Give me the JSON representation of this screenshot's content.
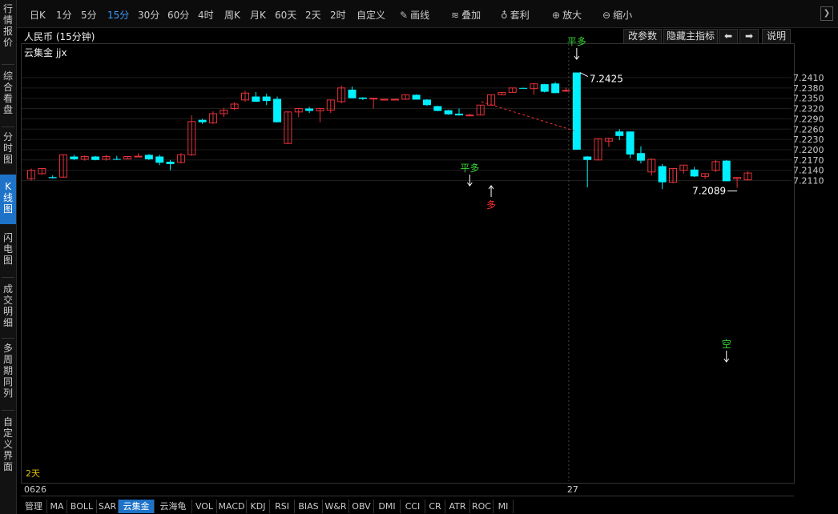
{
  "sidebar": {
    "items": [
      {
        "label": "行情报价",
        "active": false
      },
      {
        "label": "综合看盘",
        "active": false
      },
      {
        "label": "分时图",
        "active": false
      },
      {
        "label": "K线图",
        "active": true
      },
      {
        "label": "闪电图",
        "active": false
      },
      {
        "label": "成交明细",
        "active": false
      },
      {
        "label": "多周期同列",
        "active": false
      },
      {
        "label": "自定义界面",
        "active": false
      }
    ]
  },
  "toolbar": {
    "periods": [
      "日K",
      "1分",
      "5分",
      "15分",
      "30分",
      "60分",
      "4时",
      "周K",
      "月K",
      "60天",
      "2天",
      "2时",
      "自定义"
    ],
    "active_period": "15分",
    "draw_label": "画线",
    "overlay_label": "叠加",
    "arbitrage_label": "套利",
    "zoom_in_label": "放大",
    "zoom_out_label": "缩小"
  },
  "chart_header": {
    "title": "人民币 (15分钟)",
    "indicator": "云集金 jjx",
    "change_params": "改参数",
    "hide_main": "隐藏主指标",
    "explain": "说明"
  },
  "signals": {
    "pingduo": "平多",
    "duo": "多",
    "kong": "空",
    "high_value": "7.2425",
    "low_value": "7.2089"
  },
  "period_label": "2天",
  "x_axis": {
    "labels": [
      {
        "text": "0626",
        "index": 0
      },
      {
        "text": "27",
        "index": 38
      }
    ]
  },
  "bottom_tabs": [
    "管理",
    "MA",
    "BOLL",
    "SAR",
    "云集金",
    "云海龟",
    "VOL",
    "MACD",
    "KDJ",
    "RSI",
    "BIAS",
    "W&R",
    "OBV",
    "DMI",
    "CCI",
    "CR",
    "ATR",
    "ROC",
    "MI"
  ],
  "active_tab": "云集金",
  "colors": {
    "up": "#e8313a",
    "down": "#00f0ff",
    "bg": "#000000",
    "grid": "#1e1e1e",
    "active": "#1e73c8",
    "signal_green": "#36d636",
    "signal_red": "#ff3030"
  },
  "chart_data": {
    "type": "candlestick",
    "title": "人民币 (15分钟)",
    "ylim": [
      7.2075,
      7.244
    ],
    "y_ticks": [
      "7.2410",
      "7.2380",
      "7.2350",
      "7.2320",
      "7.2290",
      "7.2260",
      "7.2230",
      "7.2200",
      "7.2170",
      "7.2140",
      "7.2110"
    ],
    "grid": true,
    "candles": [
      {
        "o": 7.2115,
        "h": 7.2145,
        "l": 7.211,
        "c": 7.214
      },
      {
        "o": 7.213,
        "h": 7.2145,
        "l": 7.2127,
        "c": 7.2145
      },
      {
        "o": 7.212,
        "h": 7.2125,
        "l": 7.2116,
        "c": 7.2117
      },
      {
        "o": 7.212,
        "h": 7.2185,
        "l": 7.2118,
        "c": 7.2185
      },
      {
        "o": 7.218,
        "h": 7.2185,
        "l": 7.217,
        "c": 7.2172
      },
      {
        "o": 7.2172,
        "h": 7.2183,
        "l": 7.2168,
        "c": 7.218
      },
      {
        "o": 7.218,
        "h": 7.2182,
        "l": 7.2169,
        "c": 7.217
      },
      {
        "o": 7.2172,
        "h": 7.2185,
        "l": 7.2168,
        "c": 7.218
      },
      {
        "o": 7.2173,
        "h": 7.2182,
        "l": 7.217,
        "c": 7.2172
      },
      {
        "o": 7.2173,
        "h": 7.218,
        "l": 7.2172,
        "c": 7.218
      },
      {
        "o": 7.218,
        "h": 7.2189,
        "l": 7.2178,
        "c": 7.2181
      },
      {
        "o": 7.2185,
        "h": 7.2187,
        "l": 7.217,
        "c": 7.2172
      },
      {
        "o": 7.218,
        "h": 7.2185,
        "l": 7.2155,
        "c": 7.2162
      },
      {
        "o": 7.2165,
        "h": 7.217,
        "l": 7.214,
        "c": 7.2158
      },
      {
        "o": 7.2163,
        "h": 7.219,
        "l": 7.216,
        "c": 7.2185
      },
      {
        "o": 7.2185,
        "h": 7.23,
        "l": 7.2182,
        "c": 7.2282
      },
      {
        "o": 7.2287,
        "h": 7.229,
        "l": 7.2275,
        "c": 7.228
      },
      {
        "o": 7.2278,
        "h": 7.2312,
        "l": 7.2275,
        "c": 7.2305
      },
      {
        "o": 7.2305,
        "h": 7.2322,
        "l": 7.2295,
        "c": 7.2315
      },
      {
        "o": 7.232,
        "h": 7.2338,
        "l": 7.2315,
        "c": 7.2333
      },
      {
        "o": 7.2345,
        "h": 7.2372,
        "l": 7.234,
        "c": 7.2365
      },
      {
        "o": 7.2355,
        "h": 7.2368,
        "l": 7.234,
        "c": 7.234
      },
      {
        "o": 7.2355,
        "h": 7.2363,
        "l": 7.233,
        "c": 7.2342
      },
      {
        "o": 7.2348,
        "h": 7.2355,
        "l": 7.228,
        "c": 7.228
      },
      {
        "o": 7.2218,
        "h": 7.2312,
        "l": 7.2218,
        "c": 7.231
      },
      {
        "o": 7.231,
        "h": 7.2318,
        "l": 7.2295,
        "c": 7.232
      },
      {
        "o": 7.232,
        "h": 7.2325,
        "l": 7.2307,
        "c": 7.2313
      },
      {
        "o": 7.2313,
        "h": 7.2322,
        "l": 7.228,
        "c": 7.232
      },
      {
        "o": 7.2315,
        "h": 7.2345,
        "l": 7.2307,
        "c": 7.2345
      },
      {
        "o": 7.234,
        "h": 7.2387,
        "l": 7.2335,
        "c": 7.238
      },
      {
        "o": 7.2375,
        "h": 7.2384,
        "l": 7.235,
        "c": 7.235
      },
      {
        "o": 7.2352,
        "h": 7.2353,
        "l": 7.2345,
        "c": 7.2348
      },
      {
        "o": 7.2349,
        "h": 7.235,
        "l": 7.232,
        "c": 7.235
      },
      {
        "o": 7.2347,
        "h": 7.2348,
        "l": 7.2346,
        "c": 7.2347
      },
      {
        "o": 7.2347,
        "h": 7.2348,
        "l": 7.2346,
        "c": 7.2347
      },
      {
        "o": 7.2347,
        "h": 7.236,
        "l": 7.2347,
        "c": 7.236
      },
      {
        "o": 7.236,
        "h": 7.2361,
        "l": 7.2346,
        "c": 7.2346
      },
      {
        "o": 7.2346,
        "h": 7.2347,
        "l": 7.2328,
        "c": 7.233
      },
      {
        "o": 7.2327,
        "h": 7.2328,
        "l": 7.2312,
        "c": 7.2313
      },
      {
        "o": 7.2315,
        "h": 7.2316,
        "l": 7.2302,
        "c": 7.2303
      },
      {
        "o": 7.2305,
        "h": 7.232,
        "l": 7.23,
        "c": 7.23
      },
      {
        "o": 7.23,
        "h": 7.2305,
        "l": 7.2299,
        "c": 7.2301
      },
      {
        "o": 7.2301,
        "h": 7.233,
        "l": 7.23,
        "c": 7.233
      },
      {
        "o": 7.233,
        "h": 7.2362,
        "l": 7.233,
        "c": 7.236
      },
      {
        "o": 7.236,
        "h": 7.2367,
        "l": 7.236,
        "c": 7.2367
      },
      {
        "o": 7.2367,
        "h": 7.238,
        "l": 7.2366,
        "c": 7.238
      },
      {
        "o": 7.238,
        "h": 7.2381,
        "l": 7.2378,
        "c": 7.2379
      },
      {
        "o": 7.2378,
        "h": 7.2392,
        "l": 7.236,
        "c": 7.2392
      },
      {
        "o": 7.2391,
        "h": 7.2392,
        "l": 7.2367,
        "c": 7.2369
      },
      {
        "o": 7.2393,
        "h": 7.2397,
        "l": 7.2365,
        "c": 7.2365
      },
      {
        "o": 7.2373,
        "h": 7.2381,
        "l": 7.2368,
        "c": 7.2373
      },
      {
        "o": 7.2425,
        "h": 7.2425,
        "l": 7.22,
        "c": 7.22
      },
      {
        "o": 7.218,
        "h": 7.2181,
        "l": 7.209,
        "c": 7.217
      },
      {
        "o": 7.217,
        "h": 7.2232,
        "l": 7.217,
        "c": 7.2232
      },
      {
        "o": 7.2225,
        "h": 7.2235,
        "l": 7.2208,
        "c": 7.2233
      },
      {
        "o": 7.2253,
        "h": 7.226,
        "l": 7.2228,
        "c": 7.224
      },
      {
        "o": 7.2253,
        "h": 7.2253,
        "l": 7.2175,
        "c": 7.2186
      },
      {
        "o": 7.219,
        "h": 7.221,
        "l": 7.216,
        "c": 7.2168
      },
      {
        "o": 7.2135,
        "h": 7.2175,
        "l": 7.2125,
        "c": 7.2172
      },
      {
        "o": 7.2152,
        "h": 7.2158,
        "l": 7.2085,
        "c": 7.2105
      },
      {
        "o": 7.2105,
        "h": 7.2145,
        "l": 7.2102,
        "c": 7.2145
      },
      {
        "o": 7.214,
        "h": 7.2155,
        "l": 7.213,
        "c": 7.2155
      },
      {
        "o": 7.2142,
        "h": 7.215,
        "l": 7.212,
        "c": 7.2122
      },
      {
        "o": 7.2122,
        "h": 7.213,
        "l": 7.2115,
        "c": 7.213
      },
      {
        "o": 7.214,
        "h": 7.217,
        "l": 7.2135,
        "c": 7.2165
      },
      {
        "o": 7.2168,
        "h": 7.217,
        "l": 7.2108,
        "c": 7.2108
      },
      {
        "o": 7.2115,
        "h": 7.212,
        "l": 7.2089,
        "c": 7.2119
      },
      {
        "o": 7.2112,
        "h": 7.2137,
        "l": 7.211,
        "c": 7.2132
      }
    ]
  }
}
